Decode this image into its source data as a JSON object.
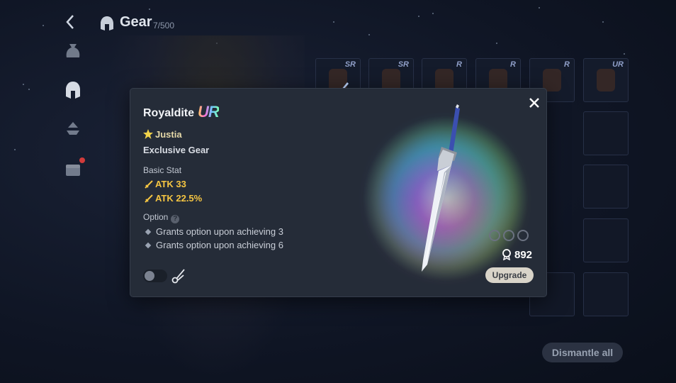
{
  "header": {
    "title": "Gear",
    "count": "7/500"
  },
  "sidebar": {
    "items": [
      {
        "name": "bag-icon"
      },
      {
        "name": "helmet-icon"
      },
      {
        "name": "anvil-icon"
      },
      {
        "name": "chest-icon"
      }
    ]
  },
  "inventory": {
    "slots": [
      {
        "rank": "SR"
      },
      {
        "rank": "SR"
      },
      {
        "rank": "R"
      },
      {
        "rank": "R"
      },
      {
        "rank": "R"
      },
      {
        "rank": "UR"
      }
    ]
  },
  "dismantle_label": "Dismantle all",
  "popup": {
    "item_name": "Royaldite",
    "rank": "UR",
    "owner": "Justia",
    "type": "Exclusive Gear",
    "basic_stat_title": "Basic Stat",
    "stats": [
      "ATK 33",
      "ATK 22.5%"
    ],
    "option_title": "Option",
    "options": [
      "Grants option upon achieving 3",
      "Grants option upon achieving 6"
    ],
    "cost": "892",
    "upgrade_label": "Upgrade",
    "colors": {
      "stat": "#f5c542",
      "panel": "#252c38"
    }
  }
}
